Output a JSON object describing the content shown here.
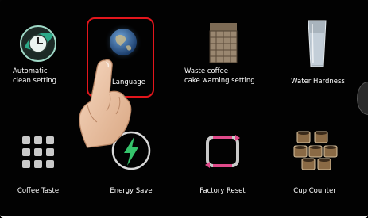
{
  "menu": {
    "items": [
      {
        "label": "Automatic\nclean setting",
        "icon": "clock-leaf-icon"
      },
      {
        "label": "Language",
        "icon": "globe-icon",
        "selected": true
      },
      {
        "label": "Waste coffee\ncake warning setting",
        "icon": "grinder-icon"
      },
      {
        "label": "Water Hardness",
        "icon": "water-glass-icon"
      },
      {
        "label": "Coffee Taste",
        "icon": "grid-icon"
      },
      {
        "label": "Energy Save",
        "icon": "lightning-icon"
      },
      {
        "label": "Factory Reset",
        "icon": "reset-frame-icon"
      },
      {
        "label": "Cup Counter",
        "icon": "cups-icon"
      }
    ]
  },
  "colors": {
    "highlight": "#e3161c",
    "background": "#020202",
    "accent_green": "#35c46b"
  },
  "pointer": "hand-pointer-icon"
}
